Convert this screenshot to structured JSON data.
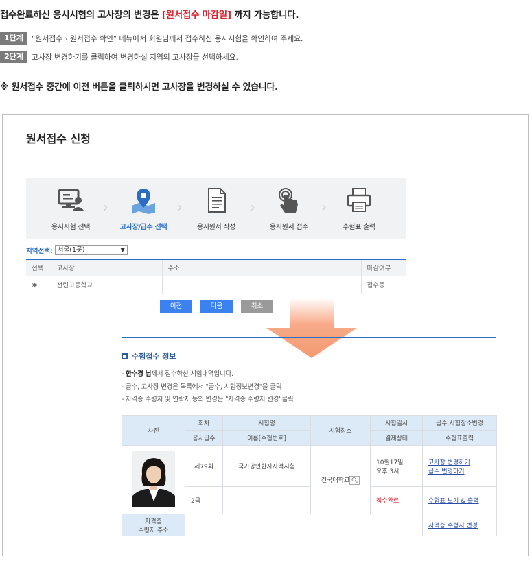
{
  "intro": {
    "title_pre": "접수완료하신 응시시험의 고사장의 변경은 ",
    "title_highlight": "[원서접수 마감일]",
    "title_post": " 까지 가능합니다.",
    "steps": [
      {
        "badge": "1단계",
        "text": "“원서접수 › 원서접수 확인” 메뉴에서 회원님께서 접수하신 응시시험을 확인하여 주세요."
      },
      {
        "badge": "2단계",
        "text": "고사장 변경하기를 클릭하여 변경하실 지역의 고사장을 선택하세요."
      }
    ],
    "note": "※  원서접수 중간에 이전 버튼을 클릭하시면 고사장을 변경하실 수 있습니다."
  },
  "app": {
    "title": "원서접수 신청",
    "stepper": [
      {
        "icon": "computer-user-icon",
        "label": "응시시험 선택"
      },
      {
        "icon": "map-pin-icon",
        "label": "고사장/급수 선택"
      },
      {
        "icon": "document-icon",
        "label": "응시원서 작성"
      },
      {
        "icon": "hand-click-icon",
        "label": "응시원서 접수"
      },
      {
        "icon": "printer-icon",
        "label": "수험표 출력"
      }
    ],
    "region_label": "지역선택:",
    "region_value": "서울(1곳)",
    "table_headers": [
      "선택",
      "고사장",
      "주소",
      "마감여부"
    ],
    "table_row": {
      "radio": "◉",
      "school": "선린고등학교",
      "address": "",
      "status": "접수중"
    },
    "buttons": {
      "prev": "이전",
      "next": "다음",
      "cancel": "취소"
    }
  },
  "info": {
    "title": "수험접수 정보",
    "name": "한수경 님",
    "bullet1_post": "께서 접수하신 시험내역입니다.",
    "bullet2": "- 급수, 고사장 변경은 목록에서 \"급수, 시험정보변경\"을 클릭",
    "bullet3": "- 자격증 수령지 및 연락처 등의 변경은 \"자격증 수령지 변경\"클릭",
    "headers": {
      "photo": "사진",
      "round": "회차",
      "exam_name": "시험명",
      "place": "시험장소",
      "datetime": "시험일시",
      "change": "급수,시험장소변경",
      "level": "응시급수",
      "name_no": "이름[수험번호]",
      "pay": "결제상태",
      "ticket": "수험표출력"
    },
    "row": {
      "round": "제79회",
      "exam_name": "국가공인한자자격시험",
      "place": "건국대학교",
      "datetime_1": "10월17일",
      "datetime_2": "오후 3시",
      "link_change_place": "고사장 변경하기",
      "link_change_level": "급수 변경하기",
      "level": "2급",
      "name_no": "",
      "pay_status": "접수완료",
      "link_ticket": "수험표 보기 & 출력"
    },
    "address_label_1": "자격증",
    "address_label_2": "수령지 주소",
    "link_address_change": "자격증 수령지 변경"
  }
}
